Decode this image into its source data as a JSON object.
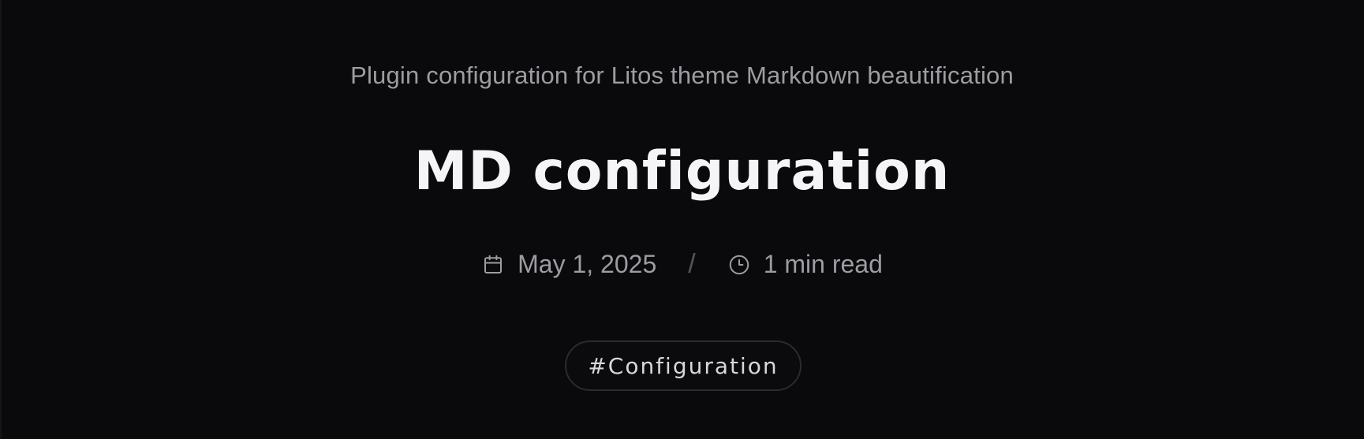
{
  "post": {
    "description": "Plugin configuration for Litos theme Markdown beautification",
    "title": "MD configuration",
    "meta": {
      "date": "May 1, 2025",
      "separator": "/",
      "reading_time": "1 min read"
    },
    "tags": [
      "#Configuration"
    ]
  },
  "icons": {
    "date": "calendar-icon",
    "reading_time": "clock-icon"
  },
  "colors": {
    "background": "#0a0a0c",
    "title": "#f5f5f7",
    "muted_text": "#9c9ca2",
    "tag_border": "#2a2a33"
  }
}
